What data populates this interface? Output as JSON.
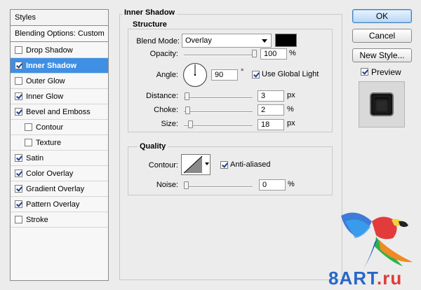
{
  "styles_panel": {
    "header": "Styles",
    "blending_options": "Blending Options: Custom",
    "items": [
      {
        "label": "Drop Shadow",
        "checked": false,
        "selected": false,
        "indent": 0
      },
      {
        "label": "Inner Shadow",
        "checked": true,
        "selected": true,
        "indent": 0
      },
      {
        "label": "Outer Glow",
        "checked": false,
        "selected": false,
        "indent": 0
      },
      {
        "label": "Inner Glow",
        "checked": true,
        "selected": false,
        "indent": 0
      },
      {
        "label": "Bevel and Emboss",
        "checked": true,
        "selected": false,
        "indent": 0
      },
      {
        "label": "Contour",
        "checked": false,
        "selected": false,
        "indent": 1
      },
      {
        "label": "Texture",
        "checked": false,
        "selected": false,
        "indent": 1
      },
      {
        "label": "Satin",
        "checked": true,
        "selected": false,
        "indent": 0
      },
      {
        "label": "Color Overlay",
        "checked": true,
        "selected": false,
        "indent": 0
      },
      {
        "label": "Gradient Overlay",
        "checked": true,
        "selected": false,
        "indent": 0
      },
      {
        "label": "Pattern Overlay",
        "checked": true,
        "selected": false,
        "indent": 0
      },
      {
        "label": "Stroke",
        "checked": false,
        "selected": false,
        "indent": 0
      }
    ]
  },
  "inner_shadow": {
    "title": "Inner Shadow",
    "structure": {
      "title": "Structure",
      "blend_mode_label": "Blend Mode:",
      "blend_mode_value": "Overlay",
      "color": "#000000",
      "opacity_label": "Opacity:",
      "opacity_value": "100",
      "opacity_unit": "%",
      "opacity_fraction": 1.0,
      "angle_label": "Angle:",
      "angle_value": "90",
      "angle_unit": "°",
      "use_global_light_label": "Use Global Light",
      "use_global_light_checked": true,
      "distance_label": "Distance:",
      "distance_value": "3",
      "distance_unit": "px",
      "distance_fraction": 0.01,
      "choke_label": "Choke:",
      "choke_value": "2",
      "choke_unit": "%",
      "choke_fraction": 0.02,
      "size_label": "Size:",
      "size_value": "18",
      "size_unit": "px",
      "size_fraction": 0.07
    },
    "quality": {
      "title": "Quality",
      "contour_label": "Contour:",
      "anti_aliased_label": "Anti-aliased",
      "anti_aliased_checked": true,
      "noise_label": "Noise:",
      "noise_value": "0",
      "noise_unit": "%",
      "noise_fraction": 0.0
    }
  },
  "buttons": {
    "ok": "OK",
    "cancel": "Cancel",
    "new_style": "New Style...",
    "preview_label": "Preview",
    "preview_checked": true
  },
  "watermark": {
    "text_a": "8ART",
    "text_b": ".ru"
  }
}
